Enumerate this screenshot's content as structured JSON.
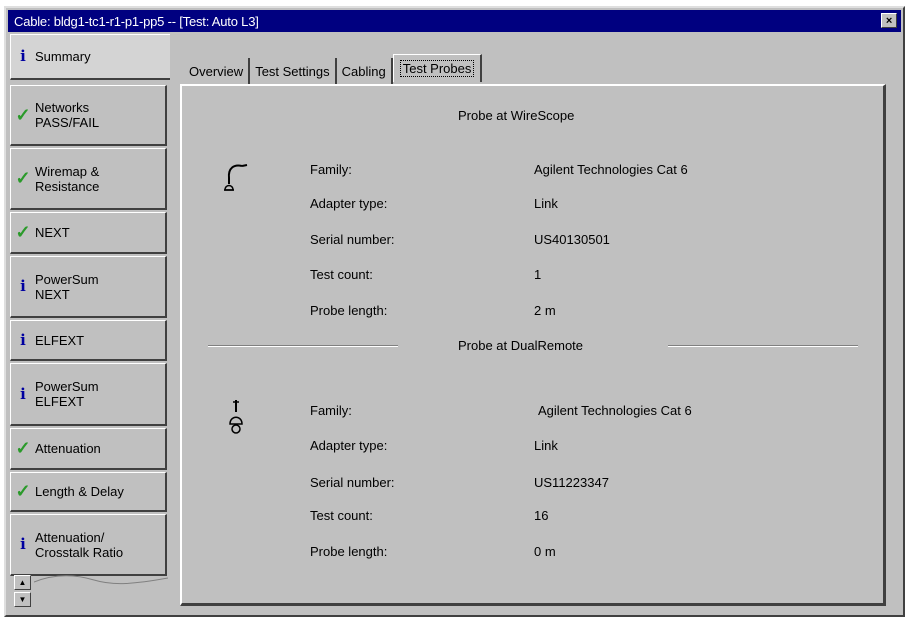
{
  "window": {
    "title": "Cable: bldg1-tc1-r1-p1-pp5 -- [Test: Auto L3]",
    "close_label": "×"
  },
  "nav": {
    "items": [
      {
        "label": "Summary",
        "status": "info"
      },
      {
        "label": "Networks\nPASS/FAIL",
        "status": "pass"
      },
      {
        "label": "Wiremap &\nResistance",
        "status": "pass"
      },
      {
        "label": "NEXT",
        "status": "pass"
      },
      {
        "label": "PowerSum\nNEXT",
        "status": "info"
      },
      {
        "label": "ELFEXT",
        "status": "info"
      },
      {
        "label": "PowerSum\nELFEXT",
        "status": "info"
      },
      {
        "label": "Attenuation",
        "status": "pass"
      },
      {
        "label": "Length & Delay",
        "status": "pass"
      },
      {
        "label": "Attenuation/\nCrosstalk Ratio",
        "status": "info"
      }
    ],
    "info_glyph": "i",
    "pass_glyph": "✓"
  },
  "tabs": [
    {
      "label": "Overview"
    },
    {
      "label": "Test Settings"
    },
    {
      "label": "Cabling"
    },
    {
      "label": "Test Probes"
    }
  ],
  "probe_wirescope": {
    "title": "Probe at WireScope",
    "rows": [
      {
        "label": "Family:",
        "value": "Agilent Technologies Cat 6"
      },
      {
        "label": "Adapter type:",
        "value": "Link"
      },
      {
        "label": "Serial number:",
        "value": "US40130501"
      },
      {
        "label": "Test count:",
        "value": "1"
      },
      {
        "label": "Probe length:",
        "value": "2 m"
      }
    ]
  },
  "probe_dualremote": {
    "title": "Probe at DualRemote",
    "rows": [
      {
        "label": "Family:",
        "value": "Agilent Technologies Cat 6"
      },
      {
        "label": "Adapter type:",
        "value": "Link"
      },
      {
        "label": "Serial number:",
        "value": "US11223347"
      },
      {
        "label": "Test count:",
        "value": "16"
      },
      {
        "label": "Probe length:",
        "value": "0 m"
      }
    ]
  },
  "colors": {
    "title_bar": "#000080",
    "pass": "#2a9a2a",
    "info": "#0000a0",
    "face": "#c0c0c0"
  }
}
